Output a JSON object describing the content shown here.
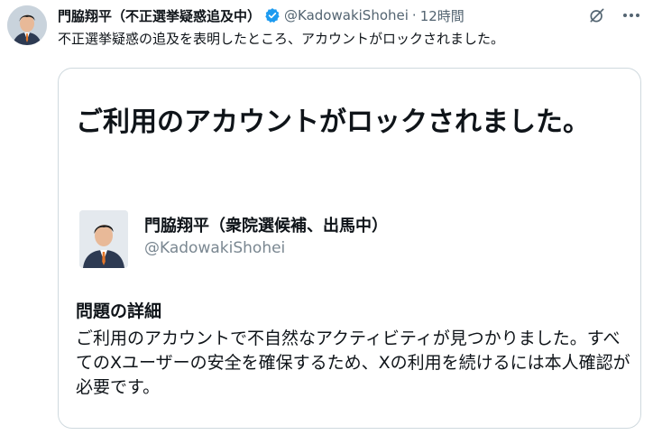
{
  "tweet": {
    "author_name": "門脇翔平（不正選挙疑惑追及中）",
    "handle": "@KadowakiShohei",
    "separator": "·",
    "time": "12時間",
    "text": "不正選挙疑惑の追及を表明したところ、アカウントがロックされました。",
    "icons": [
      "avatar",
      "verified-badge-icon",
      "grok-icon",
      "more-icon"
    ]
  },
  "card": {
    "title": "ご利用のアカウントがロックされました。",
    "user_name": "門脇翔平（衆院選候補、出馬中）",
    "user_handle": "@KadowakiShohei",
    "details_heading": "問題の詳細",
    "details_text": "ご利用のアカウントで不自然なアクティビティが見つかりました。すべてのXユーザーの安全を確保するため、Xの利用を続けるには本人確認が必要です。"
  },
  "colors": {
    "verified_blue": "#1d9bf0",
    "secondary_text": "#536471",
    "border": "#cfd9de"
  }
}
